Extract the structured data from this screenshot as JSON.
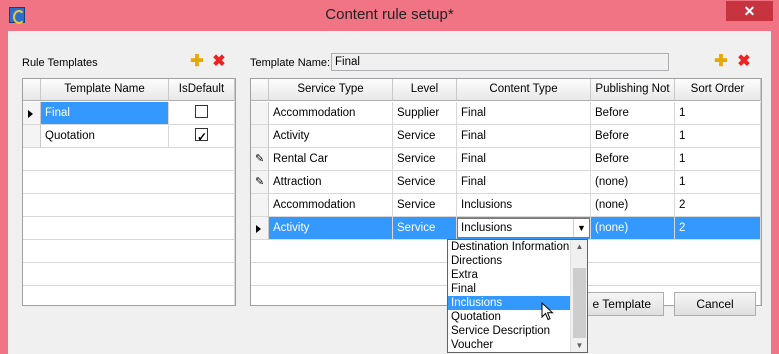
{
  "window": {
    "title": "Content rule setup*",
    "close_glyph": "✕"
  },
  "templates_panel": {
    "label": "Rule Templates",
    "columns": [
      "Template Name",
      "IsDefault"
    ],
    "rows": [
      {
        "name": "Final",
        "is_default": false,
        "selected": true
      },
      {
        "name": "Quotation",
        "is_default": true,
        "selected": false
      }
    ]
  },
  "template_name": {
    "label": "Template Name:",
    "value": "Final"
  },
  "rules_grid": {
    "columns": [
      "Service Type",
      "Level",
      "Content Type",
      "Publishing Not",
      "Sort Order"
    ],
    "rows": [
      {
        "service_type": "Accommodation",
        "level": "Supplier",
        "content_type": "Final",
        "publishing": "Before",
        "sort": "1",
        "marker": ""
      },
      {
        "service_type": "Activity",
        "level": "Service",
        "content_type": "Final",
        "publishing": "Before",
        "sort": "1",
        "marker": ""
      },
      {
        "service_type": "Rental Car",
        "level": "Service",
        "content_type": "Final",
        "publishing": "Before",
        "sort": "1",
        "marker": "pencil"
      },
      {
        "service_type": "Attraction",
        "level": "Service",
        "content_type": "Final",
        "publishing": "(none)",
        "sort": "1",
        "marker": "pencil"
      },
      {
        "service_type": "Accommodation",
        "level": "Service",
        "content_type": "Inclusions",
        "publishing": "(none)",
        "sort": "2",
        "marker": ""
      },
      {
        "service_type": "Activity",
        "level": "Service",
        "content_type": "Inclusions",
        "publishing": "(none)",
        "sort": "2",
        "marker": "arrow"
      }
    ]
  },
  "dropdown": {
    "options": [
      "Destination Information",
      "Directions",
      "Extra",
      "Final",
      "Inclusions",
      "Quotation",
      "Service Description",
      "Voucher"
    ],
    "highlighted": "Inclusions"
  },
  "buttons": {
    "save_partial": "e Template",
    "cancel": "Cancel"
  },
  "icons": {
    "add": "✚",
    "delete": "✖"
  }
}
